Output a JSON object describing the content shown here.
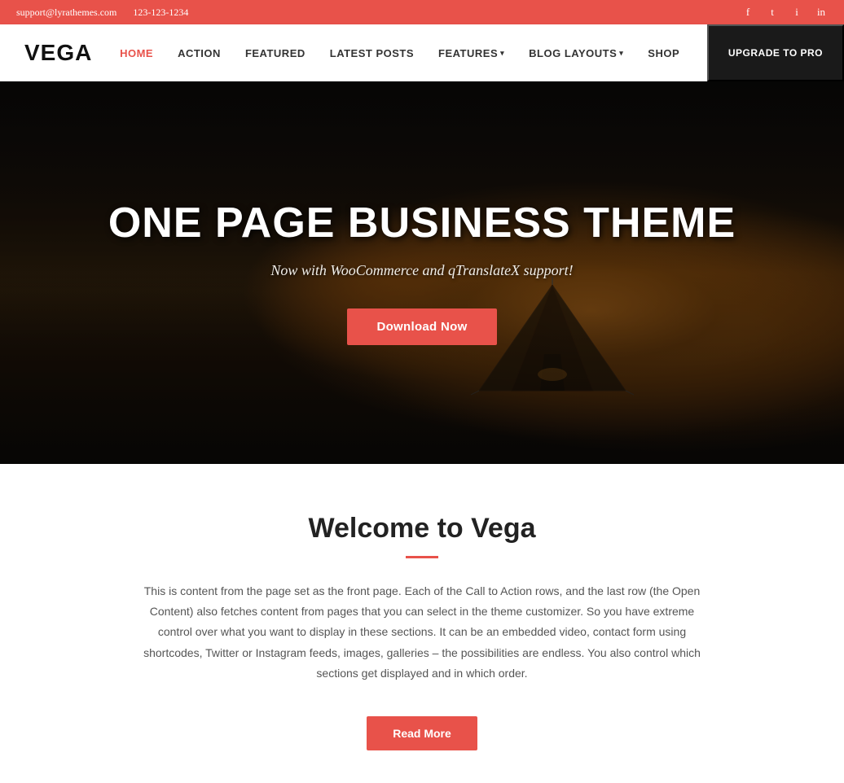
{
  "topbar": {
    "email": "support@lyrathemes.com",
    "phone": "123-123-1234",
    "social": [
      {
        "name": "facebook",
        "icon": "f"
      },
      {
        "name": "twitter",
        "icon": "t"
      },
      {
        "name": "instagram",
        "icon": "i"
      },
      {
        "name": "linkedin",
        "icon": "in"
      }
    ]
  },
  "header": {
    "logo": "VEGA",
    "nav": [
      {
        "label": "HOME",
        "active": true,
        "dropdown": false
      },
      {
        "label": "ACTION",
        "active": false,
        "dropdown": false
      },
      {
        "label": "FEATURED",
        "active": false,
        "dropdown": false
      },
      {
        "label": "LATEST POSTS",
        "active": false,
        "dropdown": false
      },
      {
        "label": "FEATURES",
        "active": false,
        "dropdown": true
      },
      {
        "label": "BLOG LAYOUTS",
        "active": false,
        "dropdown": true
      },
      {
        "label": "SHOP",
        "active": false,
        "dropdown": false
      }
    ],
    "upgrade_btn": "UPGRADE TO PRO"
  },
  "hero": {
    "title": "ONE PAGE BUSINESS THEME",
    "subtitle": "Now with WooCommerce and qTranslateX support!",
    "cta_btn": "Download Now"
  },
  "welcome": {
    "title": "Welcome to Vega",
    "body": "This is content from the page set as the front page. Each of the Call to Action rows, and the last row (the Open Content) also fetches content from pages that you can select in the theme customizer. So you have extreme control over what you want to display in these sections. It can be an embedded video, contact form using shortcodes, Twitter or Instagram feeds, images, galleries – the possibilities are endless. You also control which sections get displayed and in which order.",
    "read_more_btn": "Read More"
  },
  "colors": {
    "accent": "#e8524a",
    "dark": "#1a1a1a",
    "white": "#ffffff"
  }
}
